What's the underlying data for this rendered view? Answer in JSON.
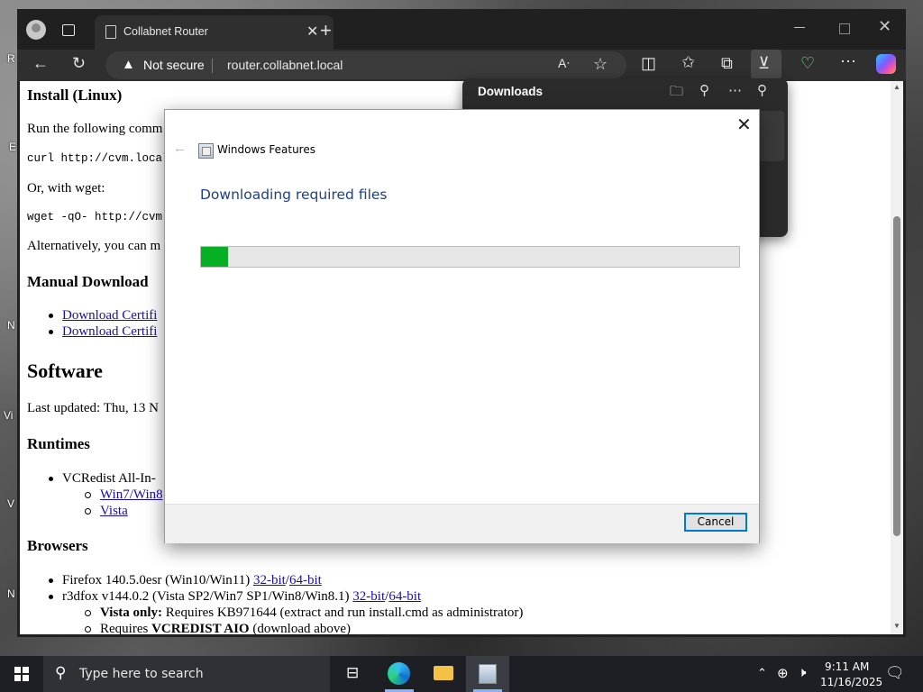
{
  "browser": {
    "tab_title": "Collabnet Router",
    "new_tab_symbol": "+",
    "not_secure": "Not secure",
    "url": "router.collabnet.local"
  },
  "downloads_panel": {
    "title": "Downloads"
  },
  "page": {
    "install_linux_heading": "Install (Linux)",
    "run_following": "Run the following comm",
    "curl_cmd": "curl http://cvm.local/",
    "or_wget": "Or, with wget:",
    "wget_cmd": "wget -qO- http://cvm.l",
    "alternatively": "Alternatively, you can m",
    "manual_download_heading": "Manual Download",
    "download_links": [
      "Download Certifi",
      "Download Certifi"
    ],
    "software_heading": "Software",
    "last_updated": "Last updated: Thu, 13 N",
    "runtimes_heading": "Runtimes",
    "vcredist": "VCRedist All-In-",
    "runtime_links": [
      "Win7/Win8",
      "Vista"
    ],
    "browsers_heading": "Browsers",
    "firefox": {
      "text": "Firefox 140.5.0esr (Win10/Win11) ",
      "link32": "32-bit",
      "sep": "/",
      "link64": "64-bit"
    },
    "r3dfox": {
      "text": "r3dfox v144.0.2 (Vista SP2/Win7 SP1/Win8/Win8.1) ",
      "link32": "32-bit",
      "sep": "/",
      "link64": "64-bit"
    },
    "vista_only_label": "Vista only:",
    "vista_only_text": " Requires KB971644 (extract and run install.cmd as administrator)",
    "requires_prefix": "Requires ",
    "requires_bold": "VCREDIST AIO",
    "requires_suffix": " (download above)"
  },
  "dialog": {
    "app_title": "Windows Features",
    "heading": "Downloading required files",
    "progress_percent": 5,
    "cancel_label": "Cancel"
  },
  "taskbar": {
    "search_placeholder": "Type here to search",
    "time": "9:11 AM",
    "date": "11/16/2025"
  },
  "colors": {
    "progress": "#06b025",
    "link": "#1a0dab",
    "dialog_heading": "#1e3f8a"
  }
}
